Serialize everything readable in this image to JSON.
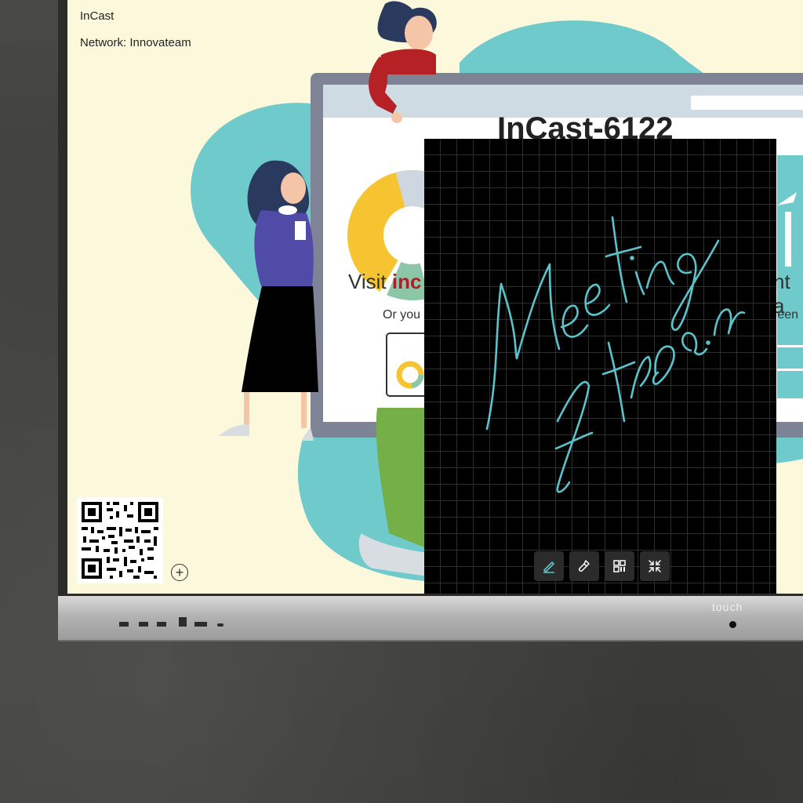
{
  "info": {
    "title": "InCast",
    "network": "Network: Innovateam"
  },
  "cast_screen": {
    "device_name": "InCast-6122",
    "visit_prefix": "Visit ",
    "visit_link_fragment": "inc",
    "instruction_fragment": "Or you",
    "right_fragment_1": "nt a",
    "right_fragment_2": "creen"
  },
  "whiteboard": {
    "handwriting_line1": "Meeting",
    "handwriting_line2": "at 10 a.m",
    "ink_color": "#5bc3cc",
    "toolbar": [
      {
        "name": "pen-tool",
        "icon": "pen-icon",
        "active": true
      },
      {
        "name": "eraser-tool",
        "icon": "brush-icon"
      },
      {
        "name": "qr-tool",
        "icon": "qr-code-icon"
      },
      {
        "name": "minimize-tool",
        "icon": "collapse-arrows-icon"
      }
    ]
  },
  "controls": {
    "add_symbol": "+"
  },
  "hardware": {
    "brand": "touch"
  },
  "colors": {
    "screen_bg": "#fcf8dc",
    "teal": "#6ecacb",
    "accent_red": "#b01c2a"
  }
}
